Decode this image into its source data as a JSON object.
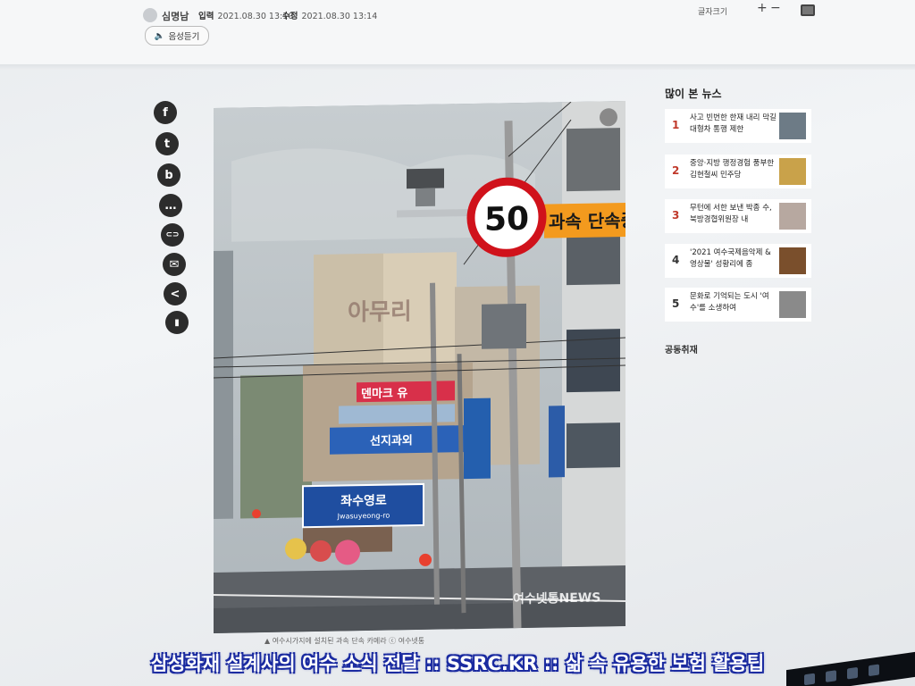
{
  "article_header": {
    "author": "심명남",
    "published_label": "입력",
    "published": "2021.08.30 13:10",
    "modified_label": "수정",
    "modified": "2021.08.30 13:14",
    "listen_label": "음성듣기",
    "font_size_label": "글자크기",
    "plus": "+",
    "minus": "−"
  },
  "share_buttons": [
    "f",
    "t",
    "b",
    "…",
    "⊂⊃",
    "✉",
    "<",
    "▮"
  ],
  "photo": {
    "watermark": "여수넷통NEWS",
    "speed_limit": "50",
    "enforcement_sign": "과속 단속중",
    "road_sign": "좌수영로",
    "road_sign_sub": "Jwasuyeong-ro",
    "shop_sign": "덴마크 유",
    "building_sign": "선지과외",
    "roof_text": "아무리"
  },
  "photo_caption": "▲ 여수시가지에 설치된 과속 단속 카메라 ⓒ 여수넷통",
  "sidebar": {
    "title": "많이 본 뉴스",
    "news": [
      {
        "rank": "1",
        "title": "사고 빈번한 한재 내리 막길 대형차 통행 제한"
      },
      {
        "rank": "2",
        "title": "중앙·지방 행정경험 풍부한 김현철씨 민주당"
      },
      {
        "rank": "3",
        "title": "무턴에 서한 보낸 박종 수, 북방경협위원장 내"
      },
      {
        "rank": "4",
        "title": "'2021 여수국제음악제 & 영상물' 성황리에 종"
      },
      {
        "rank": "5",
        "title": "문화로 기억되는 도시 '여수'를 소생하여"
      }
    ],
    "section2": "공동취재"
  },
  "banner": "삼성화재 설계사의 여수 소식 전달 :: SSRC.KR :: 삶 속 유용한 보험 활용팁",
  "colors": {
    "rank_red": "#c0392b",
    "banner_outline": "#1a2aa0",
    "speed_ring": "#d0121b",
    "sign_orange": "#f39a1e"
  }
}
